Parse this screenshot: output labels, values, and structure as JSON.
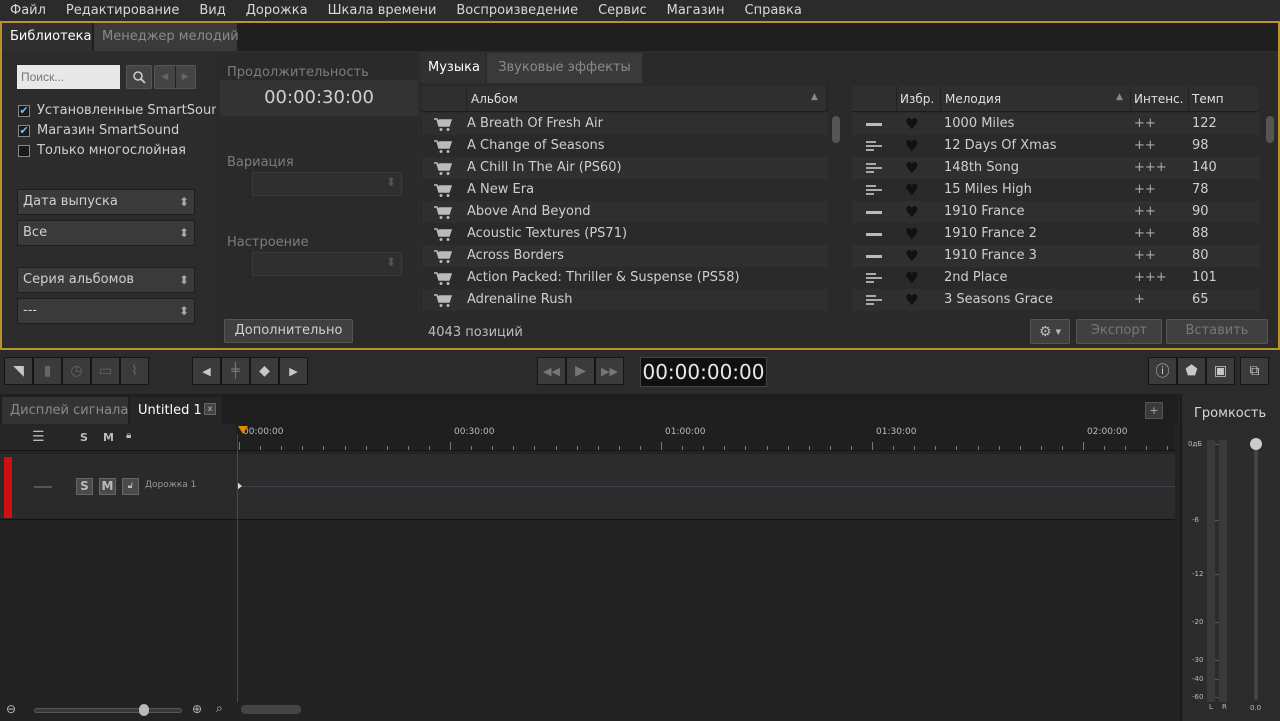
{
  "menu": [
    "Файл",
    "Редактирование",
    "Вид",
    "Дорожка",
    "Шкала времени",
    "Воспроизведение",
    "Сервис",
    "Магазин",
    "Справка"
  ],
  "lib_tabs": {
    "library": "Библиотека",
    "manager": "Менеджер мелодий"
  },
  "search": {
    "placeholder": "Поиск..."
  },
  "filters": {
    "installed": "Установленные SmartSound",
    "store": "Магазин SmartSound",
    "multilayer": "Только многослойная"
  },
  "selects": {
    "date": "Дата выпуска",
    "all": "Все",
    "series": "Серия альбомов",
    "dash": "---"
  },
  "mid": {
    "duration_label": "Продолжительность",
    "duration": "00:00:30:00",
    "variation": "Вариация",
    "mood": "Настроение",
    "more": "Дополнительно"
  },
  "music_tabs": {
    "music": "Музыка",
    "sfx": "Звуковые эффекты"
  },
  "album_header": "Альбом",
  "albums": [
    "A Breath Of Fresh Air",
    "A Change of Seasons",
    "A Chill In The Air (PS60)",
    "A New Era",
    "Above And Beyond",
    "Acoustic Textures (PS71)",
    "Across Borders",
    "Action Packed: Thriller & Suspense (PS58)",
    "Adrenaline Rush"
  ],
  "song_headers": {
    "fav": "Избр.",
    "song": "Мелодия",
    "intensity": "Интенс.",
    "tempo": "Темп"
  },
  "songs": [
    {
      "name": "1000 Miles",
      "int": "++",
      "tempo": "122"
    },
    {
      "name": "12 Days Of Xmas",
      "int": "++",
      "tempo": "98"
    },
    {
      "name": "148th Song",
      "int": "+++",
      "tempo": "140"
    },
    {
      "name": "15 Miles High",
      "int": "++",
      "tempo": "78"
    },
    {
      "name": "1910 France",
      "int": "++",
      "tempo": "90"
    },
    {
      "name": "1910 France 2",
      "int": "++",
      "tempo": "88"
    },
    {
      "name": "1910 France 3",
      "int": "++",
      "tempo": "80"
    },
    {
      "name": "2nd Place",
      "int": "+++",
      "tempo": "101"
    },
    {
      "name": "3 Seasons Grace",
      "int": "+",
      "tempo": "65"
    }
  ],
  "footer": {
    "count": "4043 позиций",
    "export": "Экспорт",
    "insert": "Вставить"
  },
  "transport": {
    "time": "00:00:00:00"
  },
  "tl_tabs": {
    "signal": "Дисплей сигнала",
    "untitled": "Untitled 1",
    "close": "x"
  },
  "track": {
    "s": "S",
    "m": "M",
    "name": "Дорожка 1"
  },
  "ruler": [
    "00:00:00",
    "00:30:00",
    "01:00:00",
    "01:30:00",
    "02:00:00"
  ],
  "volume": {
    "title": "Громкость",
    "db": [
      "0дБ",
      "-6",
      "-12",
      "-20",
      "-30",
      "-40",
      "-60"
    ],
    "l": "L",
    "r": "R",
    "value": "0.0"
  },
  "colors": {
    "accent": "#b8922a",
    "track": "#d01010"
  }
}
